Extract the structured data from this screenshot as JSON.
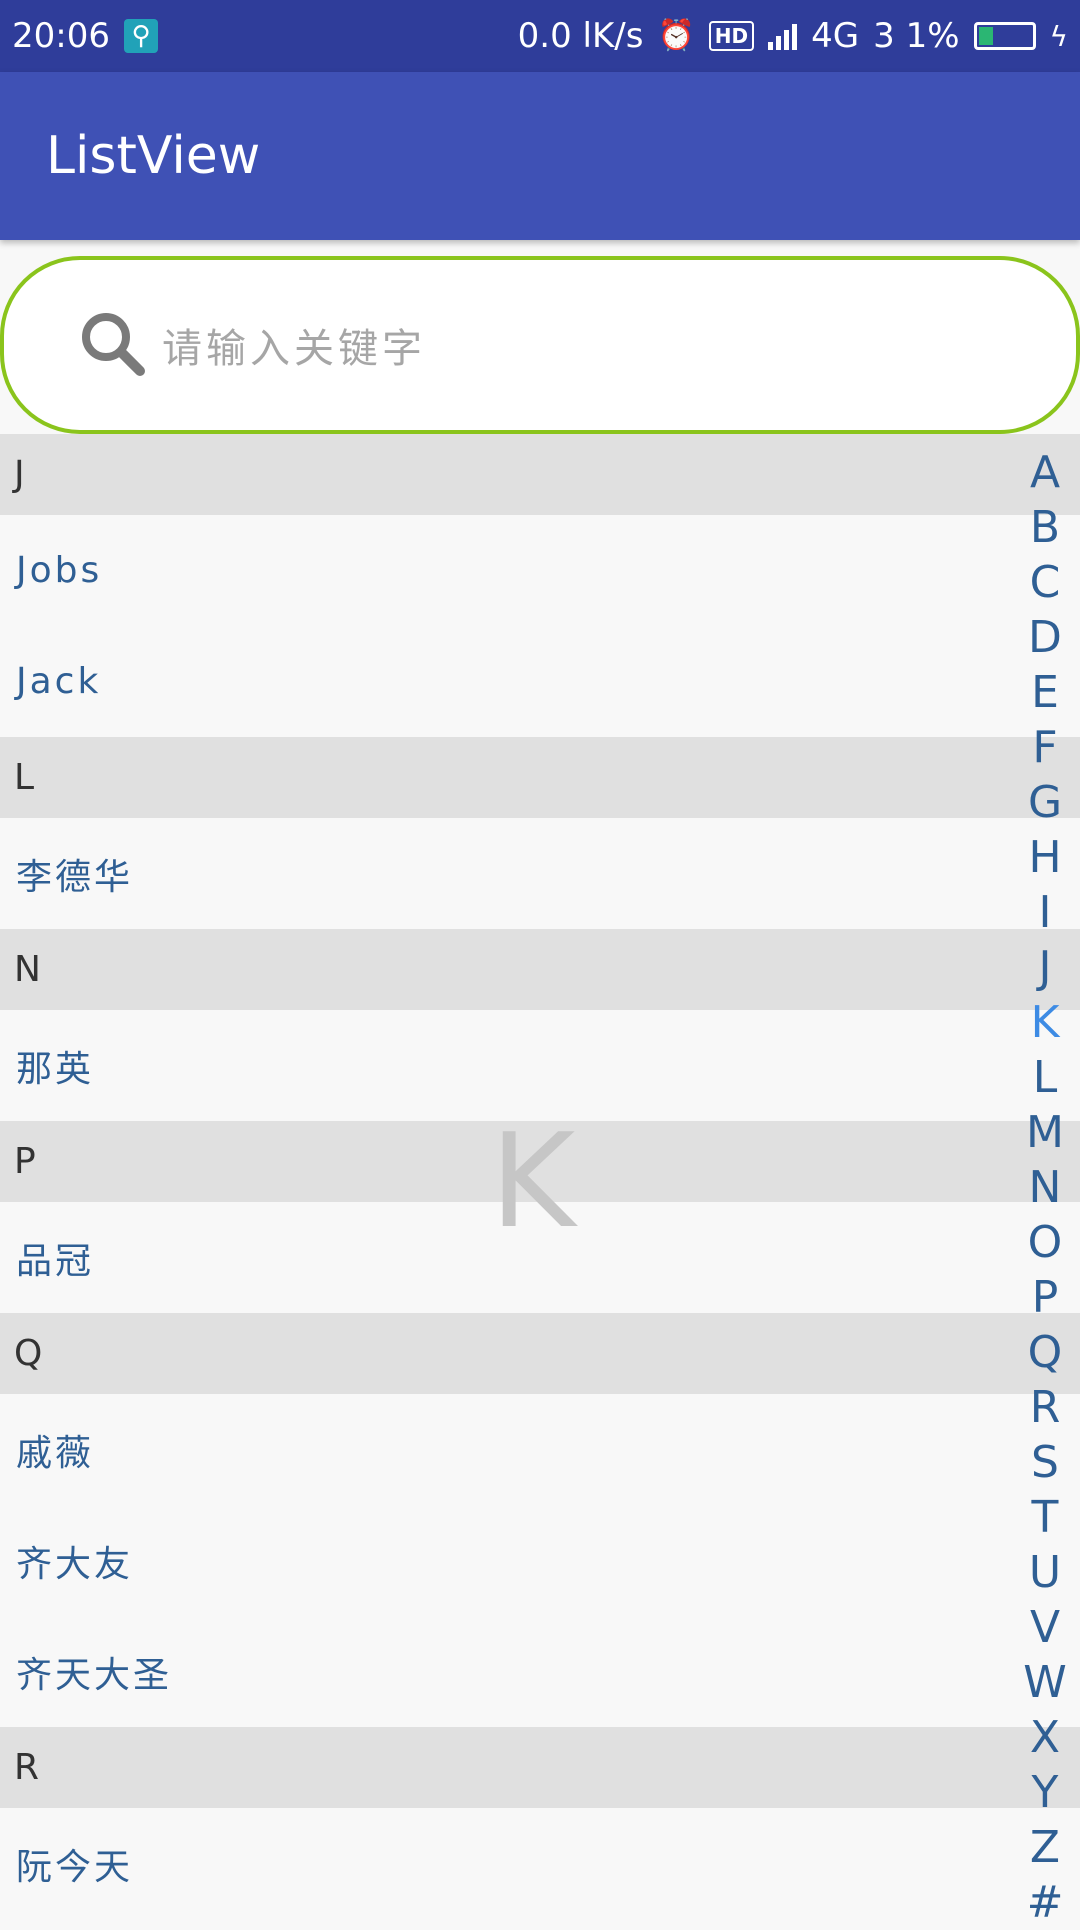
{
  "status_bar": {
    "time": "20:06",
    "network_speed": "0.0 lK/s",
    "hd_label": "HD",
    "network_type": "4G",
    "battery_percent": "3 1%",
    "icons": [
      "usb-icon",
      "alarm-icon",
      "hd-icon",
      "signal-icon",
      "battery-icon",
      "charging-bolt-icon"
    ]
  },
  "app_bar": {
    "title": "ListView"
  },
  "search": {
    "placeholder": "请输入关键字"
  },
  "sections": [
    {
      "header": "J",
      "items": [
        "Jobs",
        "Jack"
      ]
    },
    {
      "header": "L",
      "items": [
        "李德华"
      ]
    },
    {
      "header": "N",
      "items": [
        "那英"
      ]
    },
    {
      "header": "P",
      "items": [
        "品冠"
      ]
    },
    {
      "header": "Q",
      "items": [
        "戚薇",
        "齐大友",
        "齐天大圣"
      ]
    },
    {
      "header": "R",
      "items": [
        "阮今天"
      ]
    }
  ],
  "index_bar": {
    "letters": [
      "A",
      "B",
      "C",
      "D",
      "E",
      "F",
      "G",
      "H",
      "I",
      "J",
      "K",
      "L",
      "M",
      "N",
      "O",
      "P",
      "Q",
      "R",
      "S",
      "T",
      "U",
      "V",
      "W",
      "X",
      "Y",
      "Z",
      "#"
    ],
    "active": "K"
  },
  "overlay_letter": "K",
  "colors": {
    "status_bar": "#2f3d9a",
    "app_bar": "#3f51b5",
    "search_border": "#8ac41c",
    "section_header": "#e0e0e0",
    "item_text": "#2f5f94",
    "active_index": "#3d8be4"
  }
}
